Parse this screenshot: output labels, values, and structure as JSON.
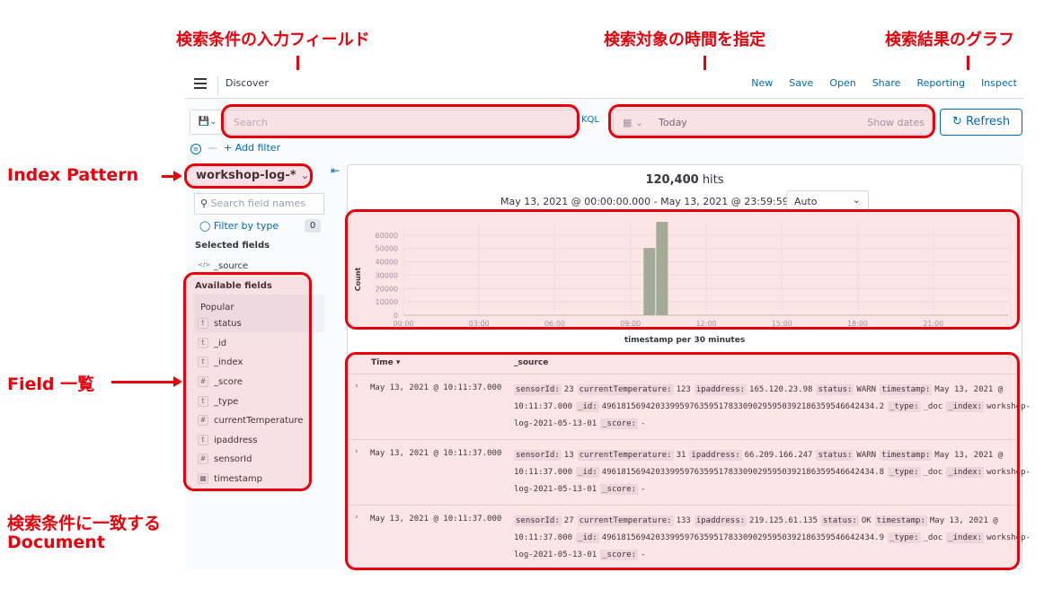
{
  "annotations": {
    "query_input": "検索条件の入力フィールド",
    "time_range": "検索対象の時間を指定",
    "result_graph": "検索結果のグラフ",
    "index_pattern": "Index Pattern",
    "field_list": "Field 一覧",
    "matching_docs_line1": "検索条件に一致する",
    "matching_docs_line2": "Document"
  },
  "header": {
    "title": "Discover",
    "links": [
      "New",
      "Save",
      "Open",
      "Share",
      "Reporting",
      "Inspect"
    ]
  },
  "query": {
    "placeholder": "Search",
    "language": "KQL",
    "date_value": "Today",
    "show_dates": "Show dates",
    "refresh_label": "Refresh",
    "add_filter": "+ Add filter"
  },
  "sidebar": {
    "index_pattern": "workshop-log-*",
    "field_search_placeholder": "Search field names",
    "filter_by_type": "Filter by type",
    "filter_count": "0",
    "selected_title": "Selected fields",
    "selected_fields": [
      {
        "type": "</>",
        "name": "_source"
      }
    ],
    "available_title": "Available fields",
    "popular_title": "Popular",
    "available_fields": [
      {
        "type": "t",
        "name": "status"
      },
      {
        "type": "t",
        "name": "_id"
      },
      {
        "type": "t",
        "name": "_index"
      },
      {
        "type": "#",
        "name": "_score"
      },
      {
        "type": "t",
        "name": "_type"
      },
      {
        "type": "#",
        "name": "currentTemperature"
      },
      {
        "type": "t",
        "name": "ipaddress"
      },
      {
        "type": "#",
        "name": "sensorId"
      },
      {
        "type": "cal",
        "name": "timestamp"
      }
    ]
  },
  "results": {
    "hits_count": "120,400",
    "hits_label": "hits",
    "date_range": "May 13, 2021 @ 00:00:00.000 - May 13, 2021 @ 23:59:59.999",
    "interval": "Auto",
    "chart_caption": "timestamp per 30 minutes",
    "col_time": "Time",
    "col_source": "_source",
    "rows": [
      {
        "time": "May 13, 2021 @ 10:11:37.000",
        "pairs": [
          [
            "sensorId:",
            "23"
          ],
          [
            "currentTemperature:",
            "123"
          ],
          [
            "ipaddress:",
            "165.120.23.98"
          ],
          [
            "status:",
            "WARN"
          ],
          [
            "timestamp:",
            "May 13, 2021 @ 10:11:37.000"
          ],
          [
            "_id:",
            "49618156942033995976359517833090295950392186359546642434.2"
          ],
          [
            "_type:",
            "_doc"
          ],
          [
            "_index:",
            "workshop-log-2021-05-13-01"
          ],
          [
            "_score:",
            "-"
          ]
        ]
      },
      {
        "time": "May 13, 2021 @ 10:11:37.000",
        "pairs": [
          [
            "sensorId:",
            "13"
          ],
          [
            "currentTemperature:",
            "31"
          ],
          [
            "ipaddress:",
            "66.209.166.247"
          ],
          [
            "status:",
            "WARN"
          ],
          [
            "timestamp:",
            "May 13, 2021 @ 10:11:37.000"
          ],
          [
            "_id:",
            "49618156942033995976359517833090295950392186359546642434.8"
          ],
          [
            "_type:",
            "_doc"
          ],
          [
            "_index:",
            "workshop-log-2021-05-13-01"
          ],
          [
            "_score:",
            "-"
          ]
        ]
      },
      {
        "time": "May 13, 2021 @ 10:11:37.000",
        "pairs": [
          [
            "sensorId:",
            "27"
          ],
          [
            "currentTemperature:",
            "133"
          ],
          [
            "ipaddress:",
            "219.125.61.135"
          ],
          [
            "status:",
            "OK"
          ],
          [
            "timestamp:",
            "May 13, 2021 @ 10:11:37.000"
          ],
          [
            "_id:",
            "49618156942033995976359517833090295950392186359546642434.9"
          ],
          [
            "_type:",
            "_doc"
          ],
          [
            "_index:",
            "workshop-log-2021-05-13-01"
          ],
          [
            "_score:",
            "-"
          ]
        ]
      }
    ]
  },
  "chart_data": {
    "type": "bar",
    "xlabel": "timestamp per 30 minutes",
    "ylabel": "Count",
    "x_ticks": [
      "00:00",
      "03:00",
      "06:00",
      "09:00",
      "12:00",
      "15:00",
      "18:00",
      "21:00"
    ],
    "y_ticks": [
      0,
      10000,
      20000,
      30000,
      40000,
      50000,
      60000
    ],
    "ylim": [
      0,
      70000
    ],
    "xlim_hours": [
      0,
      24
    ],
    "bar_color": "#9bbfa8",
    "categories": [
      "09:30",
      "10:00"
    ],
    "values": [
      50400,
      70000
    ]
  },
  "colors": {
    "annotation_red": "#e8000b",
    "link_blue": "#006bb4"
  }
}
